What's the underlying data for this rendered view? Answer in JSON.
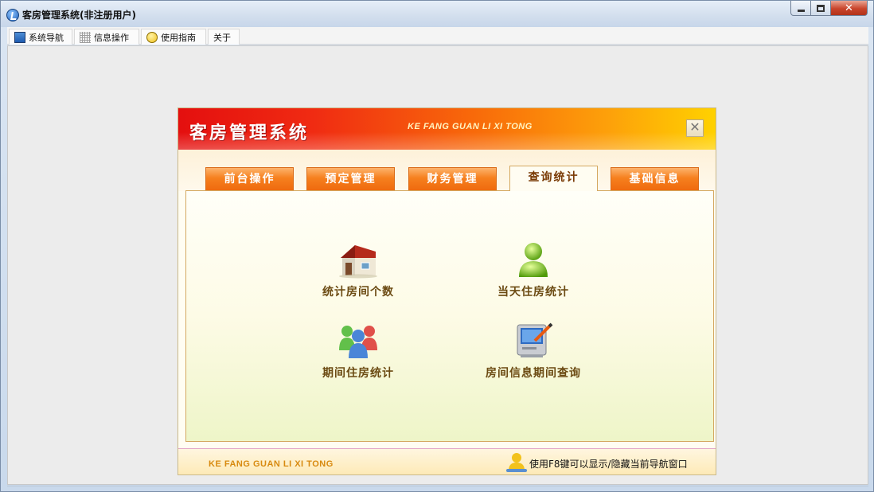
{
  "window": {
    "title": "客房管理系统(非注册用户)",
    "controls": {
      "minimize": "minimize",
      "maximize": "maximize",
      "close": "✕"
    }
  },
  "menu": {
    "tabs": [
      {
        "label": "系统导航",
        "icon": "monitor-icon"
      },
      {
        "label": "信息操作",
        "icon": "grid-icon"
      },
      {
        "label": "使用指南",
        "icon": "smile-icon"
      },
      {
        "label": "关于",
        "icon": ""
      }
    ]
  },
  "dialog": {
    "title": "客房管理系统",
    "subtitle": "KE FANG GUAN LI XI TONG",
    "close": "✕",
    "tabs": [
      "前台操作",
      "预定管理",
      "财务管理",
      "查询统计",
      "基础信息"
    ],
    "active_tab": "查询统计",
    "items": [
      {
        "label": "统计房间个数",
        "icon": "house-icon"
      },
      {
        "label": "当天住房统计",
        "icon": "person-icon"
      },
      {
        "label": "期间住房统计",
        "icon": "people-icon"
      },
      {
        "label": "房间信息期间查询",
        "icon": "computer-edit-icon"
      }
    ],
    "footer": {
      "brand": "KE FANG GUAN LI XI TONG",
      "hint": "使用F8键可以显示/隐藏当前导航窗口"
    }
  },
  "colors": {
    "header_start": "#e40f0f",
    "header_end": "#ffd200",
    "tab_orange": "#f6801e",
    "label_brown": "#6b4a12"
  }
}
